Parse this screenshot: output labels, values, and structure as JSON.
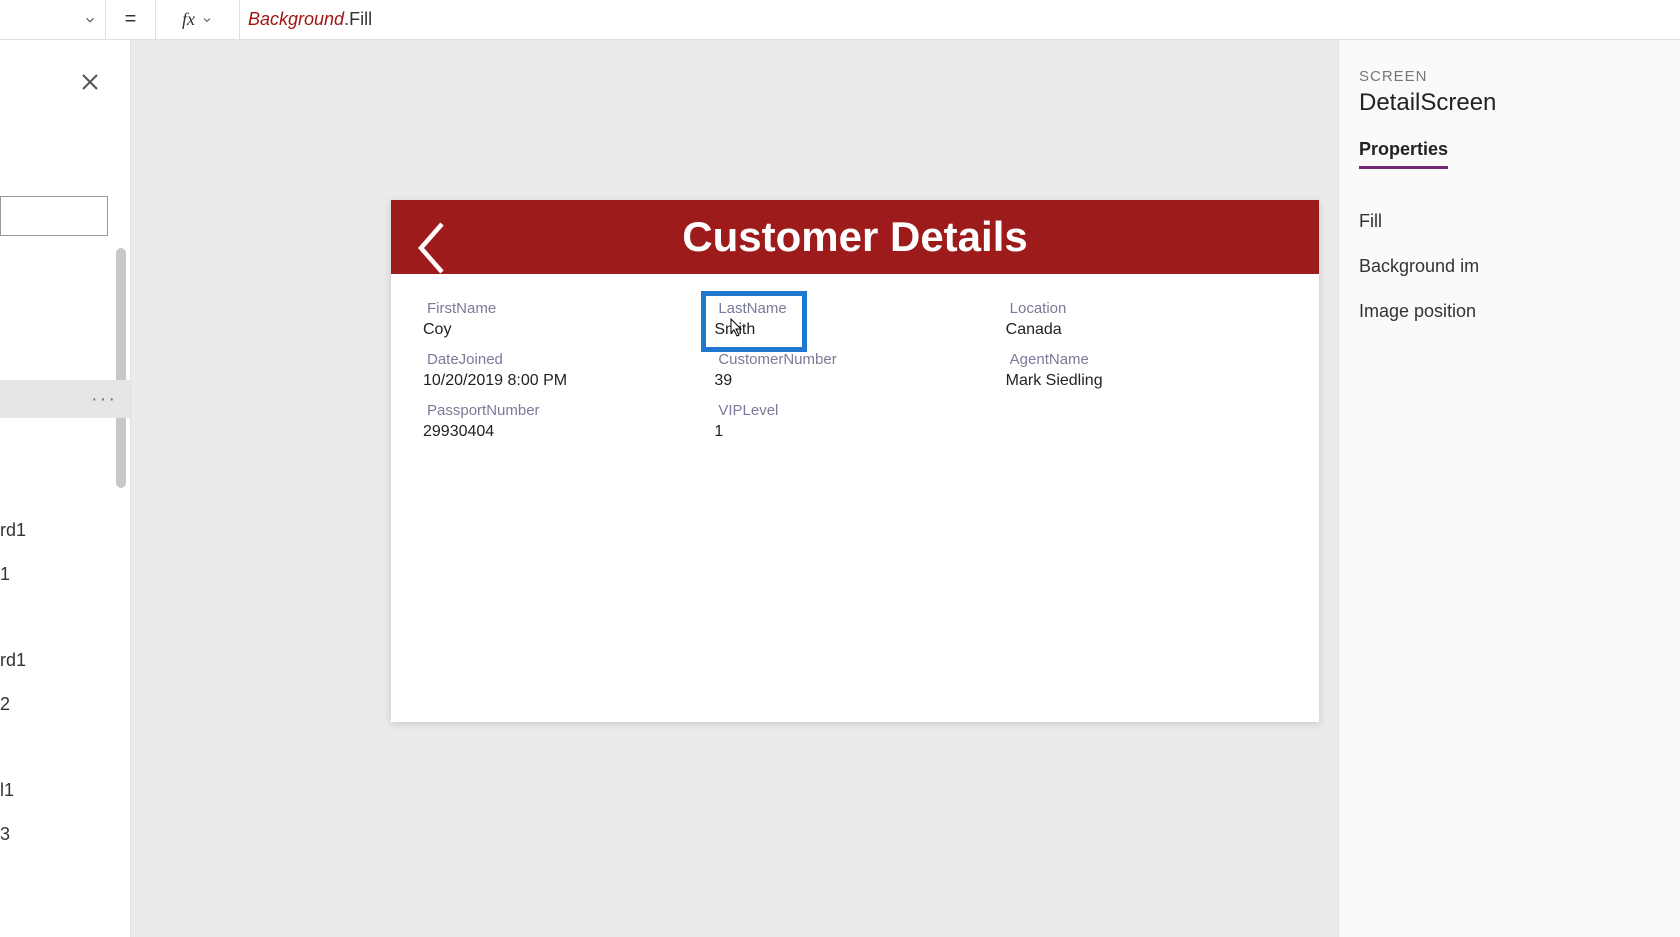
{
  "formulaBar": {
    "equals": "=",
    "fx": "fx",
    "formula_italic": "Background",
    "formula_plain": ".Fill"
  },
  "leftPanel": {
    "selected_more": "···",
    "tree_items": [
      "rd1",
      "1",
      "rd1",
      "2",
      "l1",
      "3"
    ]
  },
  "canvas": {
    "header_title": "Customer Details",
    "fields": {
      "firstName_label": "FirstName",
      "firstName_value": "Coy",
      "lastName_label": "LastName",
      "lastName_value": "Smith",
      "location_label": "Location",
      "location_value": "Canada",
      "dateJoined_label": "DateJoined",
      "dateJoined_value": "10/20/2019 8:00 PM",
      "customerNumber_label": "CustomerNumber",
      "customerNumber_value": "39",
      "agentName_label": "AgentName",
      "agentName_value": "Mark Siedling",
      "passportNumber_label": "PassportNumber",
      "passportNumber_value": "29930404",
      "vipLevel_label": "VIPLevel",
      "vipLevel_value": "1"
    }
  },
  "rightPanel": {
    "caption": "SCREEN",
    "title": "DetailScreen",
    "tab_properties": "Properties",
    "prop_fill": "Fill",
    "prop_bg_image": "Background im",
    "prop_img_position": "Image position"
  }
}
